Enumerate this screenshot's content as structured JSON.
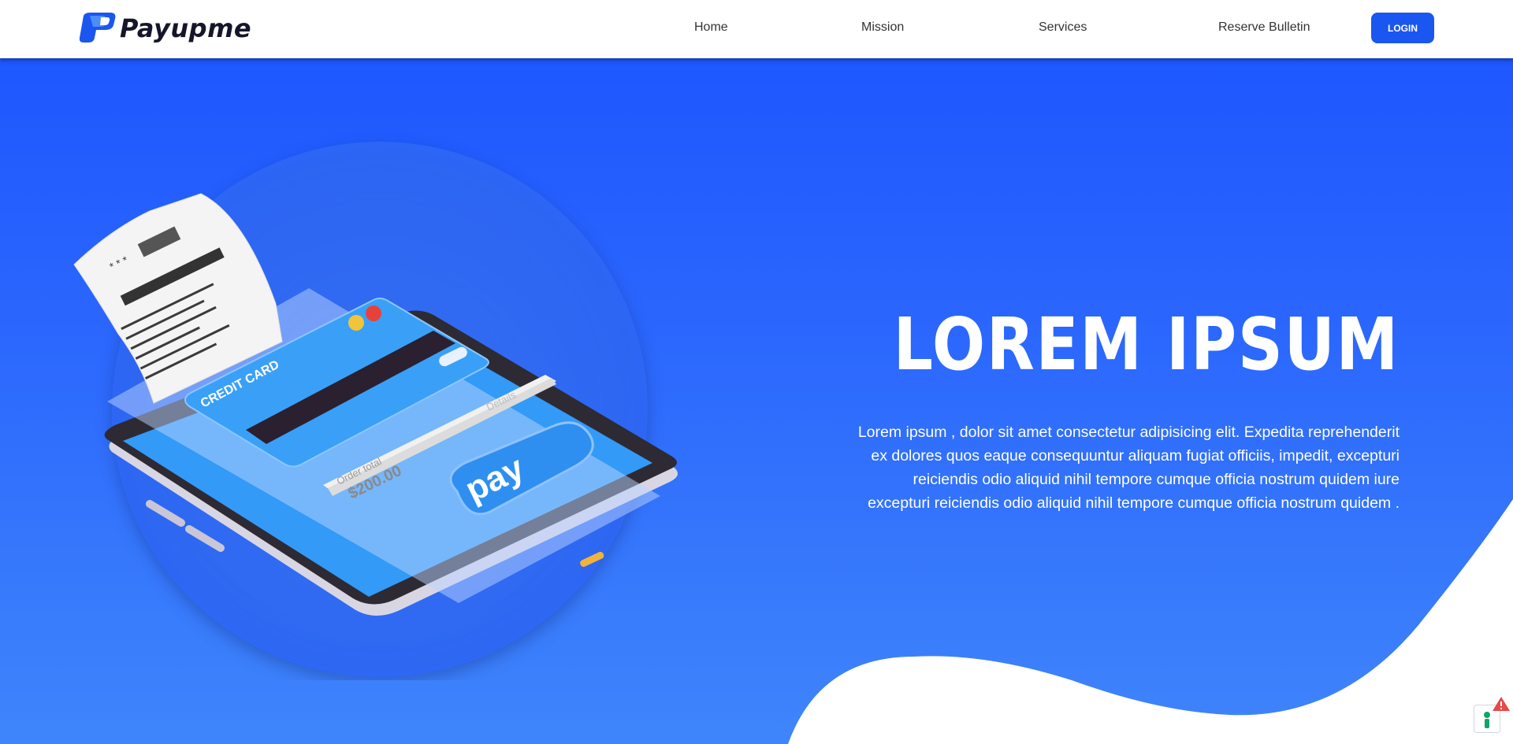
{
  "brand": {
    "name": "Payupme",
    "logo_icon": "payupme-logo-icon"
  },
  "nav": {
    "links": [
      "Home",
      "Mission",
      "Services",
      "Reserve Bulletin"
    ],
    "login_label": "LOGIN"
  },
  "hero": {
    "title": "LOREM IPSUM",
    "text": "Lorem ipsum , dolor sit amet consectetur adipisicing elit. Expedita reprehenderit ex dolores quos eaque consequuntur aliquam fugiat officiis, impedit, excepturi reiciendis odio aliquid nihil tempore cumque officia nostrum quidem iure excepturi reiciendis odio aliquid nihil tempore cumque officia nostrum quidem ."
  },
  "illustration": {
    "card_label": "CREDIT CARD",
    "order_label": "Order total",
    "order_amount": "$200.00",
    "details_label": "Details",
    "pay_label": "pay",
    "receipt_stars": "* * *"
  },
  "colors": {
    "accent": "#1a56f0",
    "hero_top": "#1e57ff",
    "hero_bottom": "#3f85fb",
    "brand_text": "#16162a"
  }
}
